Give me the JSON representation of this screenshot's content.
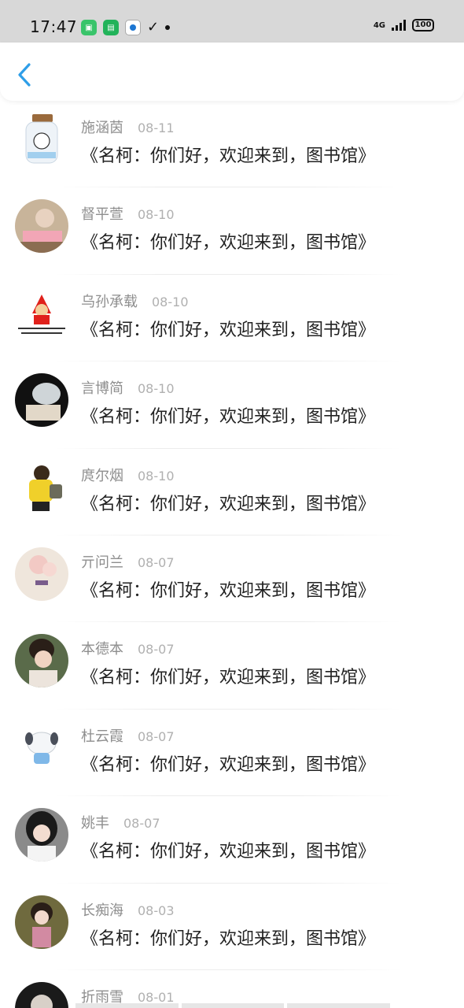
{
  "status_bar": {
    "time": "17:47",
    "network": "4G",
    "battery": "100",
    "app_icons": [
      "green-app-icon-1",
      "green-app-icon-2",
      "blue-circle-app-icon",
      "check-icon",
      "notification-dot-icon"
    ]
  },
  "header": {
    "back_icon": "chevron-left-icon",
    "accent_color": "#2e9ee8"
  },
  "items": [
    {
      "name": "施涵茵",
      "date": "08-11",
      "message": "《名柯：你们好，欢迎来到，图书馆》"
    },
    {
      "name": "督平萱",
      "date": "08-10",
      "message": "《名柯：你们好，欢迎来到，图书馆》"
    },
    {
      "name": "乌孙承载",
      "date": "08-10",
      "message": "《名柯：你们好，欢迎来到，图书馆》"
    },
    {
      "name": "言博简",
      "date": "08-10",
      "message": "《名柯：你们好，欢迎来到，图书馆》"
    },
    {
      "name": "庹尔烟",
      "date": "08-10",
      "message": "《名柯：你们好，欢迎来到，图书馆》"
    },
    {
      "name": "亓问兰",
      "date": "08-07",
      "message": "《名柯：你们好，欢迎来到，图书馆》"
    },
    {
      "name": "本德本",
      "date": "08-07",
      "message": "《名柯：你们好，欢迎来到，图书馆》"
    },
    {
      "name": "杜云霞",
      "date": "08-07",
      "message": "《名柯：你们好，欢迎来到，图书馆》"
    },
    {
      "name": "姚丰",
      "date": "08-07",
      "message": "《名柯：你们好，欢迎来到，图书馆》"
    },
    {
      "name": "长痴海",
      "date": "08-03",
      "message": "《名柯：你们好，欢迎来到，图书馆》"
    },
    {
      "name": "折雨雪",
      "date": "08-01",
      "message": ""
    }
  ]
}
